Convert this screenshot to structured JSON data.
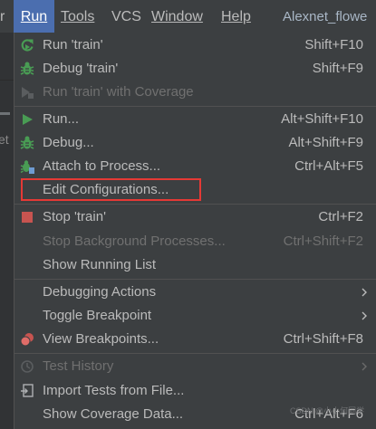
{
  "menubar": {
    "partial_left": "r",
    "run": "Run",
    "tools": "Tools",
    "vcs": "VCS",
    "window": "Window",
    "help": "Help",
    "project_title": "Alexnet_flowe"
  },
  "left_sliver": {
    "partial_text": "et"
  },
  "menu": {
    "run_train": {
      "label": "Run 'train'",
      "shortcut": "Shift+F10"
    },
    "debug_train": {
      "label": "Debug 'train'",
      "shortcut": "Shift+F9"
    },
    "run_coverage": {
      "label": "Run 'train' with Coverage"
    },
    "run": {
      "label": "Run...",
      "shortcut": "Alt+Shift+F10"
    },
    "debug": {
      "label": "Debug...",
      "shortcut": "Alt+Shift+F9"
    },
    "attach": {
      "label": "Attach to Process...",
      "shortcut": "Ctrl+Alt+F5"
    },
    "edit_config": {
      "label": "Edit Configurations..."
    },
    "stop_train": {
      "label": "Stop 'train'",
      "shortcut": "Ctrl+F2"
    },
    "stop_background": {
      "label": "Stop Background Processes...",
      "shortcut": "Ctrl+Shift+F2"
    },
    "show_running": {
      "label": "Show Running List"
    },
    "debugging_actions": {
      "label": "Debugging Actions"
    },
    "toggle_breakpoint": {
      "label": "Toggle Breakpoint"
    },
    "view_breakpoints": {
      "label": "View Breakpoints...",
      "shortcut": "Ctrl+Shift+F8"
    },
    "test_history": {
      "label": "Test History"
    },
    "import_tests": {
      "label": "Import Tests from File..."
    },
    "show_coverage": {
      "label": "Show Coverage Data...",
      "shortcut": "Ctrl+Alt+F6"
    }
  },
  "watermark": "CSDN @小小何同学",
  "colors": {
    "menu_bg": "#3c3f41",
    "text": "#bbbbbb",
    "disabled_text": "#707070",
    "active_menu": "#4b6eaf",
    "run_green": "#499c54",
    "stop_red": "#c75450",
    "highlight_border": "#e53935"
  }
}
